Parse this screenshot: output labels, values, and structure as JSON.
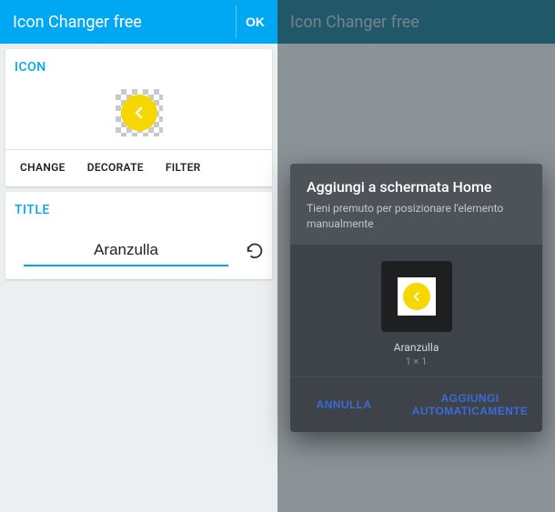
{
  "left": {
    "header": {
      "title": "Icon Changer free",
      "ok": "OK"
    },
    "iconCard": {
      "label": "ICON",
      "tabs": [
        "CHANGE",
        "DECORATE",
        "FILTER"
      ]
    },
    "titleCard": {
      "label": "TITLE",
      "value": "Aranzulla"
    }
  },
  "right": {
    "header": {
      "title": "Icon Changer free"
    },
    "dialog": {
      "title": "Aggiungi a schermata Home",
      "subtitle": "Tieni premuto per posizionare l'elemento manualmente",
      "name": "Aranzulla",
      "dimensions": "1 × 1",
      "cancel": "ANNULLA",
      "confirm": "AGGIUNGI AUTOMATICAMENTE"
    }
  }
}
